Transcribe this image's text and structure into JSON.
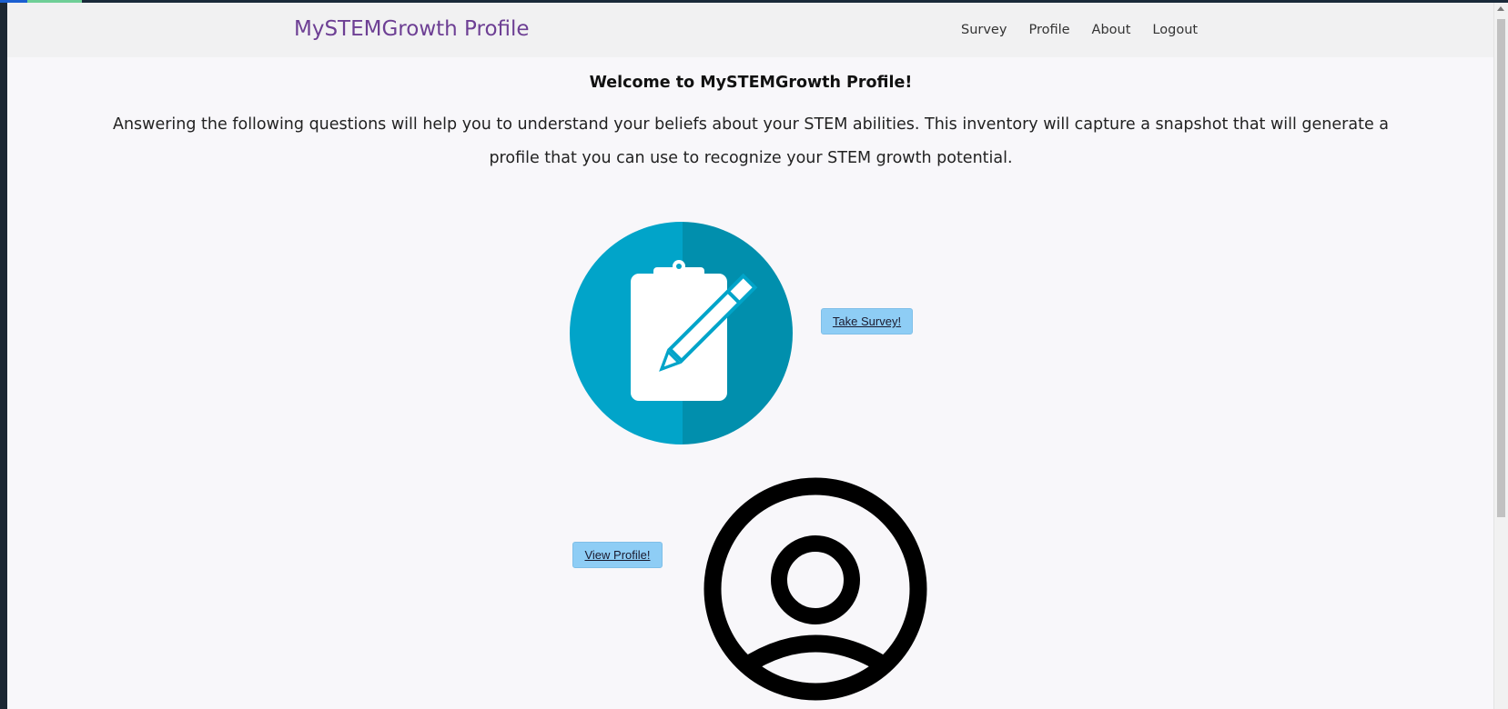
{
  "navbar": {
    "brand": "MySTEMGrowth Profile",
    "links": [
      {
        "label": "Survey"
      },
      {
        "label": "Profile"
      },
      {
        "label": "About"
      },
      {
        "label": "Logout"
      }
    ]
  },
  "main": {
    "welcome": "Welcome to MySTEMGrowth Profile!",
    "intro": "Answering the following questions will help you to understand your beliefs about your STEM abilities. This inventory will capture a snapshot that will generate a profile that you can use to recognize your STEM growth potential.",
    "survey_button": "Take Survey!",
    "profile_button": "View Profile!"
  },
  "icons": {
    "survey": "clipboard-pencil-icon",
    "profile": "user-circle-icon"
  },
  "colors": {
    "brand": "#6d3f94",
    "survey_circle_light": "#01a4c9",
    "survey_circle_dark": "#018fad",
    "button": "#8ecdf5"
  }
}
